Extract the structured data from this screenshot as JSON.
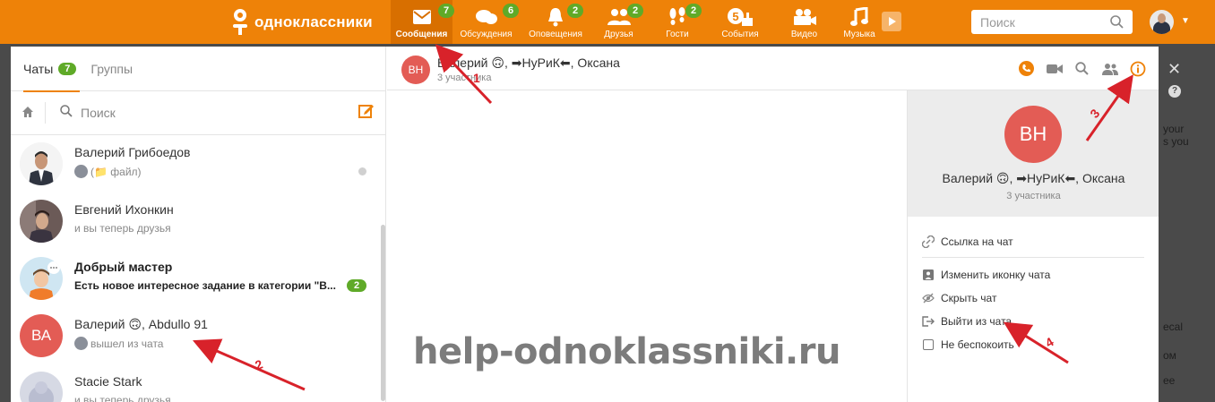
{
  "topbar": {
    "logo_text": "одноклассники",
    "nav": [
      {
        "label": "Сообщения",
        "badge": "7",
        "icon": "envelope-icon",
        "active": true
      },
      {
        "label": "Обсуждения",
        "badge": "6",
        "icon": "discussion-icon"
      },
      {
        "label": "Оповещения",
        "badge": "2",
        "icon": "bell-icon"
      },
      {
        "label": "Друзья",
        "badge": "2",
        "icon": "friends-icon"
      },
      {
        "label": "Гости",
        "badge": "2",
        "icon": "footprints-icon"
      },
      {
        "label": "События",
        "badge": "",
        "icon": "events-icon"
      },
      {
        "label": "Видео",
        "badge": "",
        "icon": "video-camera-icon"
      },
      {
        "label": "Музыка",
        "badge": "",
        "icon": "music-icon"
      }
    ],
    "search_placeholder": "Поиск"
  },
  "sidebar": {
    "tabs": [
      {
        "label": "Чаты",
        "badge": "7",
        "active": true
      },
      {
        "label": "Группы",
        "badge": ""
      }
    ],
    "search_placeholder": "Поиск",
    "chats": [
      {
        "name": "Валерий Грибоедов",
        "preview": "(📁 файл)",
        "avatar": "photo"
      },
      {
        "name": "Евгений Ихонкин",
        "preview": "и вы теперь друзья",
        "avatar": "photo"
      },
      {
        "name": "Добрый мастер",
        "preview": "Есть новое интересное задание в категории \"В...",
        "avatar": "photo",
        "unread": "2",
        "bold": true
      },
      {
        "name": "Валерий 🙃, Abdullo 91",
        "preview": "вышел из чата",
        "avatar": "initials",
        "initials": "ВА"
      },
      {
        "name": "Stacie Stark",
        "preview": "и вы теперь друзья",
        "avatar": "photo"
      }
    ]
  },
  "chat": {
    "initials": "ВН",
    "title": "Валерий 🙃, ➡НуРиК⬅, Оксана",
    "participants": "3 участника"
  },
  "info_panel": {
    "initials": "ВН",
    "title": "Валерий 🙃, ➡НуРиК⬅, Оксана",
    "participants": "3 участника",
    "menu": {
      "link": "Ссылка на чат",
      "change_icon": "Изменить иконку чата",
      "hide": "Скрыть чат",
      "leave": "Выйти из чата",
      "dnd": "Не беспокоить"
    }
  },
  "watermark": "help-odnoklassniki.ru",
  "annotations": [
    "1",
    "2",
    "3",
    "4"
  ],
  "background_text": {
    "line1": "your",
    "line2": "s you",
    "line3": "ecal",
    "line4": "ом",
    "line5": "ee"
  },
  "colors": {
    "brand_orange": "#ee8208",
    "badge_green": "#5faa28",
    "avatar_red": "#e35c55",
    "arrow_red": "#d8222a"
  }
}
